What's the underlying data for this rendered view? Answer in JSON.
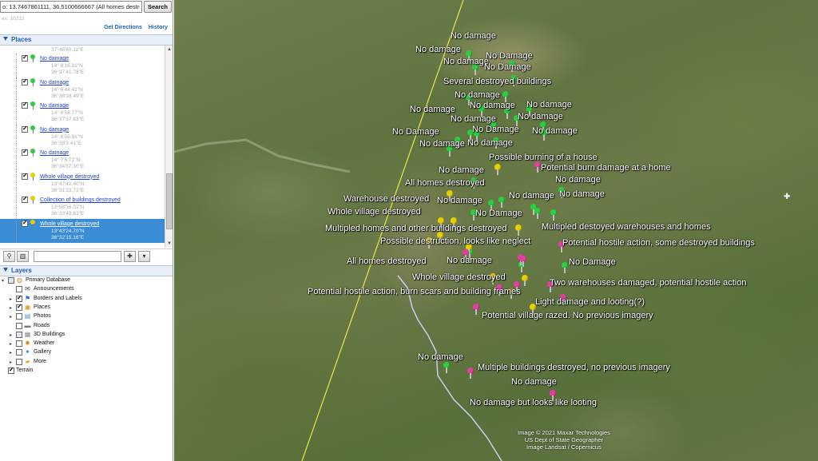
{
  "search": {
    "value": "o: 13.7467861111, 36.5100666667 (All homes destroyed)",
    "button": "Search"
  },
  "hint": "ex: 10212",
  "links": {
    "directions": "Get Directions",
    "history": "History"
  },
  "places_header": "Places",
  "layers_header": "Layers",
  "places_top_coord": "37°46'40.11\"E",
  "places": [
    {
      "title": "No damage",
      "pin_color": "#2ecc40",
      "lat": "14° 6'16.31\"N",
      "lon": "36°37'41.78\"E"
    },
    {
      "title": "No damage",
      "pin_color": "#2ecc40",
      "lat": "14° 6'48.41\"N",
      "lon": "36°38'18.49\"E"
    },
    {
      "title": "No damage",
      "pin_color": "#2ecc40",
      "lat": "14° 6'58.77\"N",
      "lon": "36°37'37.83\"E"
    },
    {
      "title": "No damage",
      "pin_color": "#2ecc40",
      "lat": "14° 6'55.91\"N",
      "lon": "36°38'3.41\"E"
    },
    {
      "title": "No damage",
      "pin_color": "#2ecc40",
      "lat": "14° 7'6.71\"N",
      "lon": "36°34'57.10\"E"
    },
    {
      "title": "Whole village destroyed",
      "pin_color": "#e8d000",
      "lat": "13°47'42.40\"N",
      "lon": "36°31'23.72\"E"
    },
    {
      "title": "Collection of buildings destroyed",
      "pin_color": "#e8d000",
      "lat": "13°58'16.02\"N",
      "lon": "36°33'49.63\"E"
    },
    {
      "title": "Whole village destroyed",
      "pin_color": "#e8d000",
      "lat": "13°43'24.70\"N",
      "lon": "36°32'15.16\"E",
      "selected": true
    }
  ],
  "layers": [
    {
      "label": "Primary Database",
      "icon": "globe-icon",
      "glyph": "◍",
      "color": "#c08a2a",
      "indent": 0,
      "checked": "part",
      "expander": "▾"
    },
    {
      "label": "Announcements",
      "icon": "envelope-icon",
      "glyph": "✉",
      "color": "#444",
      "indent": 1,
      "checked": "off",
      "expander": ""
    },
    {
      "label": "Borders and Labels",
      "icon": "flag-icon",
      "glyph": "⚑",
      "color": "#2a6cc0",
      "indent": 1,
      "checked": "on",
      "expander": "▸"
    },
    {
      "label": "Places",
      "icon": "places-icon",
      "glyph": "▣",
      "color": "#d4a02a",
      "indent": 1,
      "checked": "on",
      "expander": "▸"
    },
    {
      "label": "Photos",
      "icon": "photo-icon",
      "glyph": "▤",
      "color": "#5a8fd0",
      "indent": 1,
      "checked": "off",
      "expander": "▸"
    },
    {
      "label": "Roads",
      "icon": "road-icon",
      "glyph": "▬",
      "color": "#777",
      "indent": 1,
      "checked": "off",
      "expander": ""
    },
    {
      "label": "3D Buildings",
      "icon": "building-icon",
      "glyph": "▦",
      "color": "#888",
      "indent": 1,
      "checked": "part",
      "expander": "▸"
    },
    {
      "label": "Weather",
      "icon": "weather-icon",
      "glyph": "✹",
      "color": "#d08a10",
      "indent": 1,
      "checked": "off",
      "expander": "▸"
    },
    {
      "label": "Gallery",
      "icon": "gallery-icon",
      "glyph": "✦",
      "color": "#3a7ad0",
      "indent": 1,
      "checked": "off",
      "expander": "▸"
    },
    {
      "label": "More",
      "icon": "folder-icon",
      "glyph": "▰",
      "color": "#e0b030",
      "indent": 1,
      "checked": "off",
      "expander": "▸"
    },
    {
      "label": "Terrain",
      "icon": "terrain-icon",
      "glyph": "",
      "color": "#444",
      "indent": 0,
      "checked": "on",
      "expander": ""
    }
  ],
  "map": {
    "pins": [
      {
        "color": "#2ecc40"
      },
      {
        "color": "#2ecc40"
      },
      {
        "color": "#2ecc40"
      },
      {
        "color": "#2ecc40"
      },
      {
        "color": "#2ecc40"
      },
      {
        "color": "#2ecc40"
      },
      {
        "color": "#2ecc40"
      },
      {
        "color": "#2ecc40"
      },
      {
        "color": "#2ecc40"
      },
      {
        "color": "#2ecc40"
      },
      {
        "color": "#2ecc40"
      },
      {
        "color": "#2ecc40"
      },
      {
        "color": "#2ecc40"
      },
      {
        "color": "#2ecc40"
      },
      {
        "color": "#2ecc40"
      },
      {
        "color": "#2ecc40"
      },
      {
        "color": "#2ecc40"
      },
      {
        "color": "#2ecc40"
      },
      {
        "color": "#2ecc40"
      },
      {
        "color": "#2ecc40"
      },
      {
        "color": "#2ecc40"
      },
      {
        "color": "#2ecc40"
      },
      {
        "color": "#2ecc40"
      },
      {
        "color": "#2ecc40"
      },
      {
        "color": "#2ecc40"
      },
      {
        "color": "#2ecc40"
      },
      {
        "color": "#2ecc40"
      },
      {
        "color": "#2ecc40"
      },
      {
        "color": "#2ecc40"
      },
      {
        "color": "#2ecc40"
      },
      {
        "color": "#e8d000"
      },
      {
        "color": "#e8d000"
      },
      {
        "color": "#e8d000"
      },
      {
        "color": "#e8d000"
      },
      {
        "color": "#e8d000"
      },
      {
        "color": "#e8d000"
      },
      {
        "color": "#e8d000"
      },
      {
        "color": "#e8d000"
      },
      {
        "color": "#e8d000"
      },
      {
        "color": "#e8d000"
      },
      {
        "color": "#e8d000"
      },
      {
        "color": "#9a8a10"
      },
      {
        "color": "#e040a0"
      },
      {
        "color": "#e040a0"
      },
      {
        "color": "#e040a0"
      },
      {
        "color": "#e040a0"
      },
      {
        "color": "#e040a0"
      },
      {
        "color": "#e040a0"
      },
      {
        "color": "#e040a0"
      },
      {
        "color": "#e040a0"
      },
      {
        "color": "#e040a0"
      },
      {
        "color": "#e040a0"
      },
      {
        "color": "#e040a0"
      },
      {
        "color": "#e040a0"
      }
    ],
    "labels": [
      "No damage",
      "No damage",
      "No Damage",
      "No damage",
      "No Damage",
      "Several destroyed buildings",
      "No damage",
      "No damage",
      "No damage",
      "No damage",
      "No damage",
      "No damage",
      "No Damage",
      "No Damage",
      "No damage",
      "No damage",
      "No damage",
      "Possible burning of a house",
      "Potential burn damage at a home",
      "No damage",
      "No damage",
      "All homes destroyed",
      "No damage",
      "Warehouse destroyed",
      "No damage",
      "No damage",
      "Whole village destroyed",
      "No Damage",
      "Multipled destoyed warehouses and homes",
      "Multipled homes and other buildings destroyed",
      "Possible destruction, looks like neglect",
      "Potential hostile action, some destroyed buildings",
      "All homes destroyed",
      "No damage",
      "No Damage",
      "Whole village destroyed",
      "Two warehouses damaged, potential hostile action",
      "Potential hostile action, burn scars and building frames",
      "Light damage and looting(?)",
      "Potential village razed. No previous imagery",
      "No damage",
      "Multiple buildings destroyed, no previous imagery",
      "No damage",
      "No damage but looks like looting"
    ],
    "attribution": [
      "Image © 2021 Maxar Technologies",
      "US Dept of State Geographer",
      "Image Landsat / Copernicus"
    ]
  }
}
